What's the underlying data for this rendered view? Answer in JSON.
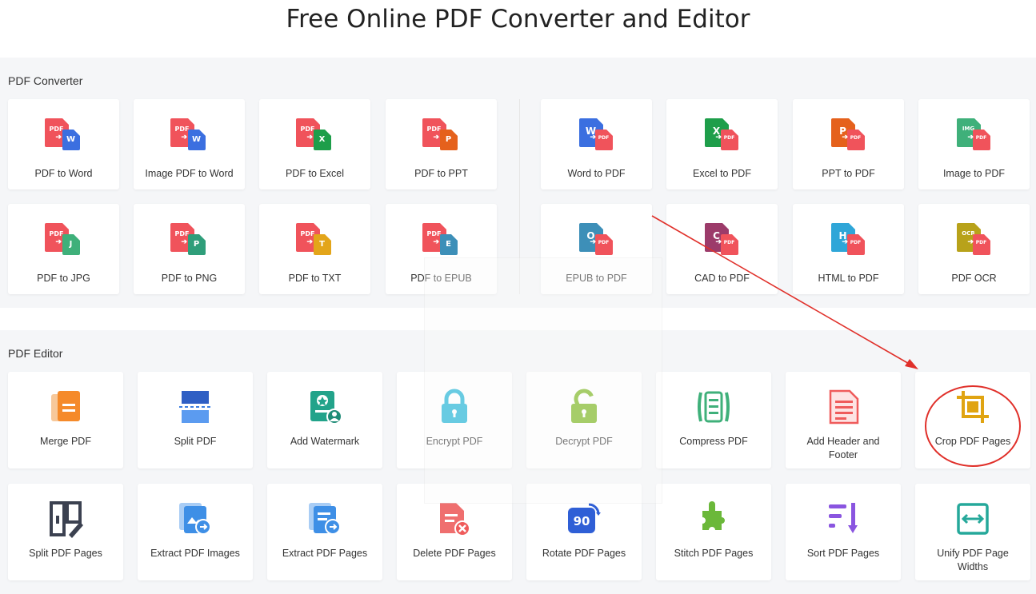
{
  "page": {
    "title": "Free Online PDF Converter and Editor"
  },
  "converter": {
    "title": "PDF Converter",
    "left": [
      {
        "label": "PDF to Word",
        "icon": "pdf-to-word-icon",
        "src": "PDF",
        "dst": "W",
        "dst_color": "#3b6fe0"
      },
      {
        "label": "Image PDF to Word",
        "icon": "image-pdf-to-word-icon",
        "src": "PDF",
        "dst": "W",
        "dst_color": "#3b6fe0"
      },
      {
        "label": "PDF to Excel",
        "icon": "pdf-to-excel-icon",
        "src": "PDF",
        "dst": "X",
        "dst_color": "#1e9e4a"
      },
      {
        "label": "PDF to PPT",
        "icon": "pdf-to-ppt-icon",
        "src": "PDF",
        "dst": "P",
        "dst_color": "#e5611c"
      },
      {
        "label": "PDF to JPG",
        "icon": "pdf-to-jpg-icon",
        "src": "PDF",
        "dst": "J",
        "dst_color": "#3fb07a"
      },
      {
        "label": "PDF to PNG",
        "icon": "pdf-to-png-icon",
        "src": "PDF",
        "dst": "P",
        "dst_color": "#2f9e7a"
      },
      {
        "label": "PDF to TXT",
        "icon": "pdf-to-txt-icon",
        "src": "PDF",
        "dst": "T",
        "dst_color": "#e3a51a"
      },
      {
        "label": "PDF to EPUB",
        "icon": "pdf-to-epub-icon",
        "src": "PDF",
        "dst": "E",
        "dst_color": "#3d8fb8"
      }
    ],
    "right": [
      {
        "label": "Word to PDF",
        "icon": "word-to-pdf-icon",
        "src": "W",
        "src_color": "#3b6fe0"
      },
      {
        "label": "Excel to PDF",
        "icon": "excel-to-pdf-icon",
        "src": "X",
        "src_color": "#1e9e4a"
      },
      {
        "label": "PPT to PDF",
        "icon": "ppt-to-pdf-icon",
        "src": "P",
        "src_color": "#e5611c"
      },
      {
        "label": "Image to PDF",
        "icon": "image-to-pdf-icon",
        "src": "IMG",
        "src_color": "#3fb07a"
      },
      {
        "label": "EPUB to PDF",
        "icon": "epub-to-pdf-icon",
        "src": "O",
        "src_color": "#3d8fb8"
      },
      {
        "label": "CAD to PDF",
        "icon": "cad-to-pdf-icon",
        "src": "C",
        "src_color": "#9c3b6a"
      },
      {
        "label": "HTML to PDF",
        "icon": "html-to-pdf-icon",
        "src": "H",
        "src_color": "#2fa6d8"
      },
      {
        "label": "PDF OCR",
        "icon": "pdf-ocr-icon",
        "src": "OCR",
        "src_color": "#b8a21a"
      }
    ],
    "pdf_label": "PDF"
  },
  "editor": {
    "title": "PDF Editor",
    "items": [
      {
        "label": "Merge PDF",
        "icon": "merge-pdf-icon"
      },
      {
        "label": "Split PDF",
        "icon": "split-pdf-icon"
      },
      {
        "label": "Add Watermark",
        "icon": "add-watermark-icon"
      },
      {
        "label": "Encrypt PDF",
        "icon": "encrypt-pdf-icon"
      },
      {
        "label": "Decrypt PDF",
        "icon": "decrypt-pdf-icon"
      },
      {
        "label": "Compress PDF",
        "icon": "compress-pdf-icon"
      },
      {
        "label": "Add Header and Footer",
        "icon": "add-header-footer-icon"
      },
      {
        "label": "Crop PDF Pages",
        "icon": "crop-pdf-pages-icon"
      },
      {
        "label": "Split PDF Pages",
        "icon": "split-pdf-pages-icon"
      },
      {
        "label": "Extract PDF Images",
        "icon": "extract-pdf-images-icon"
      },
      {
        "label": "Extract PDF Pages",
        "icon": "extract-pdf-pages-icon"
      },
      {
        "label": "Delete PDF Pages",
        "icon": "delete-pdf-pages-icon"
      },
      {
        "label": "Rotate PDF Pages",
        "icon": "rotate-pdf-pages-icon",
        "badge": "90"
      },
      {
        "label": "Stitch PDF Pages",
        "icon": "stitch-pdf-pages-icon"
      },
      {
        "label": "Sort PDF Pages",
        "icon": "sort-pdf-pages-icon"
      },
      {
        "label": "Unify PDF Page Widths",
        "icon": "unify-pdf-page-widths-icon"
      }
    ]
  },
  "colors": {
    "pdf_red": "#f0535b",
    "annotation_red": "#e0302a",
    "section_bg": "#f5f6f8"
  }
}
